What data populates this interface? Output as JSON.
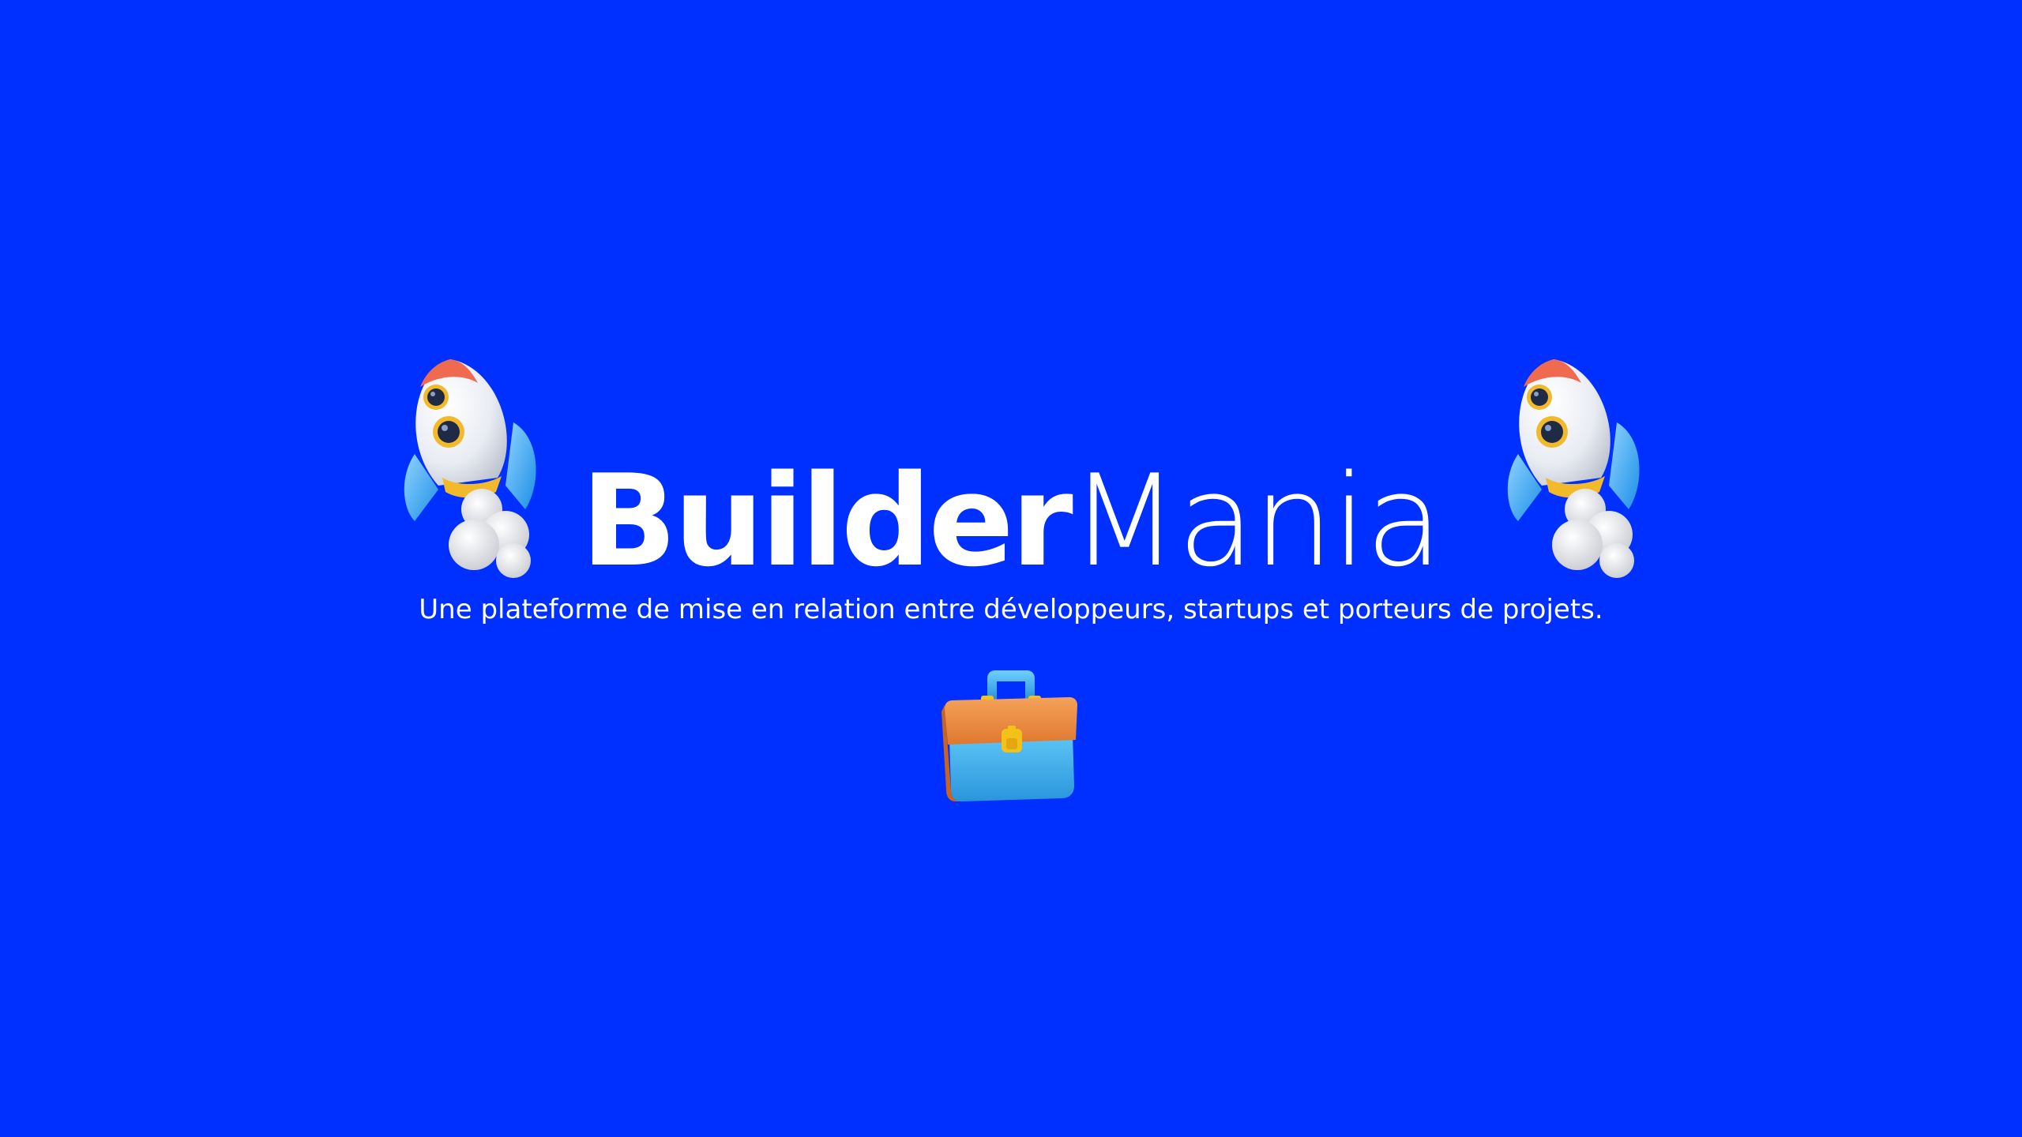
{
  "brand": {
    "name_bold": "Builder",
    "name_light": "Mania"
  },
  "tagline": "Une plateforme de mise en relation entre développeurs, startups et porteurs de projets.",
  "icons": {
    "left": "rocket-icon",
    "right": "rocket-icon",
    "center": "briefcase-icon"
  },
  "colors": {
    "background": "#0030FF",
    "text": "#FFFFFF"
  }
}
